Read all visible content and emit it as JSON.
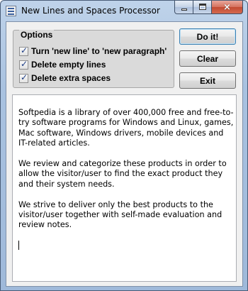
{
  "window": {
    "title": "New Lines and Spaces Processor"
  },
  "caption_buttons": {
    "minimize": "minimize",
    "maximize": "maximize",
    "close": "×"
  },
  "options": {
    "legend": "Options",
    "items": [
      {
        "label": "Turn 'new line' to 'new paragraph'",
        "checked": true
      },
      {
        "label": "Delete empty lines",
        "checked": true
      },
      {
        "label": "Delete extra spaces",
        "checked": true
      }
    ],
    "check_glyph": "✓"
  },
  "buttons": {
    "do_it": "Do it!",
    "clear": "Clear",
    "exit": "Exit"
  },
  "editor": {
    "paragraphs": [
      "Softpedia is a library of over 400,000 free and free-to-try software programs for Windows and Linux, games, Mac software, Windows drivers, mobile devices and IT-related articles.",
      "We review and categorize these products in order to allow the visitor/user to find the exact product they and their system needs.",
      "We strive to deliver only the best products to the visitor/user together with self-made evaluation and review notes."
    ]
  },
  "colors": {
    "titlebar": "#a9c2e0",
    "client": "#f0f0f0",
    "close_button": "#c24a32"
  }
}
